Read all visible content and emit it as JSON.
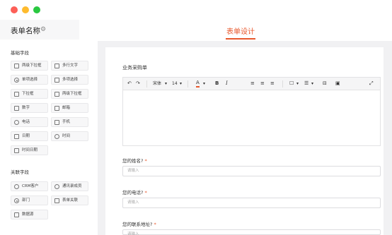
{
  "window": {
    "controls": [
      "close",
      "minimize",
      "maximize"
    ]
  },
  "header": {
    "form_name": "表单名称",
    "tab_design": "表单设计"
  },
  "sidebar": {
    "basic_title": "基础字段",
    "basic_fields": [
      {
        "label": "两级下拉框",
        "icon": "cascade-icon"
      },
      {
        "label": "多行文字",
        "icon": "multiline-icon"
      },
      {
        "label": "单项选择",
        "icon": "radio-icon"
      },
      {
        "label": "多项选择",
        "icon": "checkbox-icon"
      },
      {
        "label": "下拉框",
        "icon": "dropdown-icon"
      },
      {
        "label": "两级下拉框",
        "icon": "cascade-icon"
      },
      {
        "label": "数字",
        "icon": "number-icon"
      },
      {
        "label": "邮箱",
        "icon": "mail-icon"
      },
      {
        "label": "电话",
        "icon": "phone-icon"
      },
      {
        "label": "手机",
        "icon": "mobile-icon"
      },
      {
        "label": "日期",
        "icon": "calendar-icon"
      },
      {
        "label": "时间",
        "icon": "clock-icon"
      },
      {
        "label": "时间日期",
        "icon": "datetime-icon"
      }
    ],
    "related_title": "关联字段",
    "related_fields": [
      {
        "label": "CRM客户",
        "icon": "customer-icon"
      },
      {
        "label": "通讯录成员",
        "icon": "contact-icon"
      },
      {
        "label": "部门",
        "icon": "department-icon"
      },
      {
        "label": "表单关联",
        "icon": "link-icon"
      },
      {
        "label": "数据源",
        "icon": "datasource-icon"
      }
    ]
  },
  "canvas": {
    "form_title": "业务采购单",
    "toolbar": {
      "font": "宋体",
      "size": "14"
    },
    "fields": [
      {
        "label": "您的姓名?",
        "required": "*",
        "placeholder": "请输入"
      },
      {
        "label": "您的电话?",
        "required": "*",
        "placeholder": "请输入"
      },
      {
        "label": "您的联系地址?",
        "required": "*",
        "placeholder": "请输入"
      }
    ]
  }
}
